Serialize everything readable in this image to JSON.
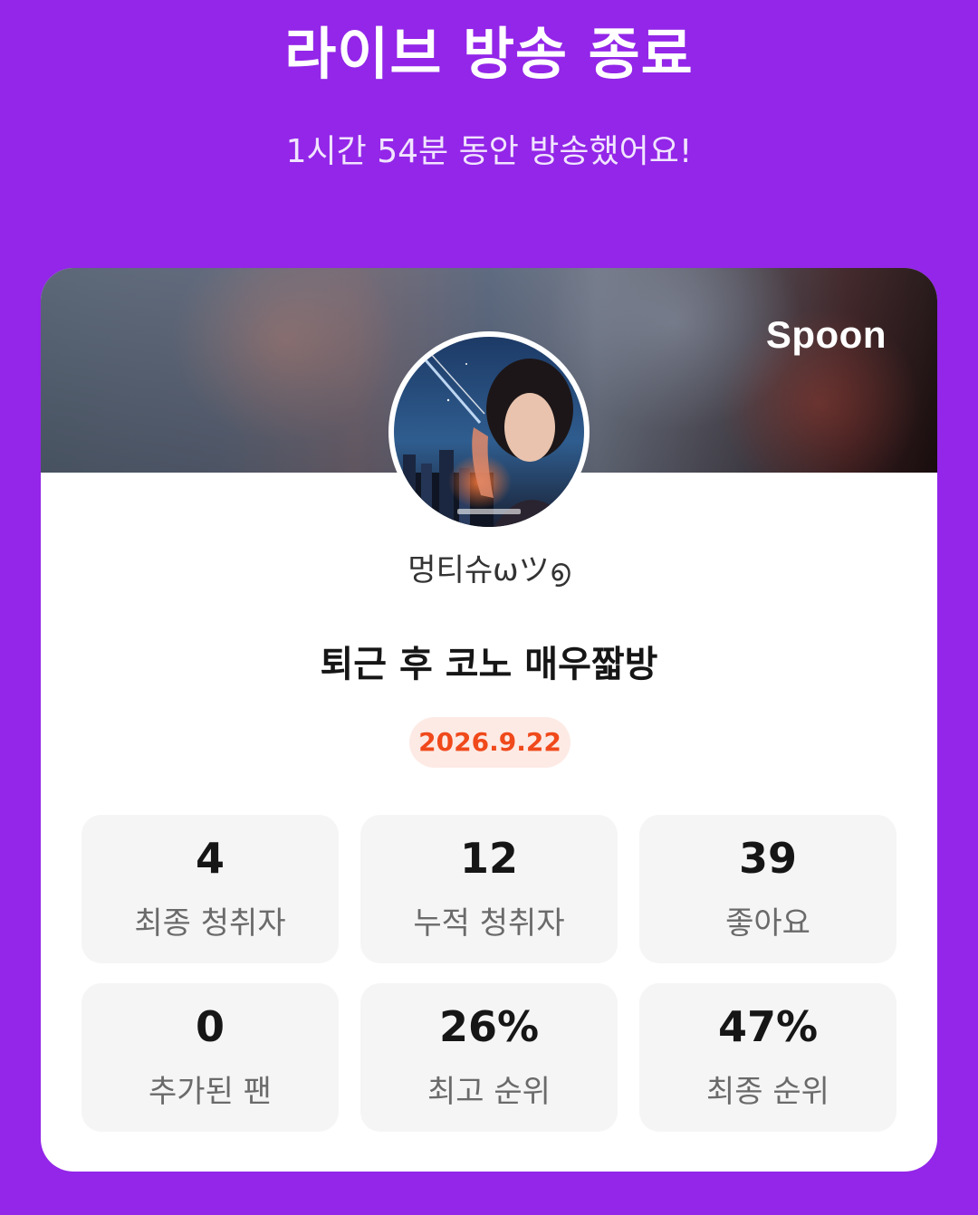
{
  "header": {
    "title": "라이브 방송 종료",
    "subtitle": "1시간 54분 동안 방송했어요!"
  },
  "card": {
    "brand": "Spoon",
    "username": "멍티슈ѡツ൭",
    "live_title": "퇴근 후 코노  매우짧방",
    "date": "2026.9.22"
  },
  "stats": [
    {
      "value": "4",
      "label": "최종 청취자"
    },
    {
      "value": "12",
      "label": "누적 청취자"
    },
    {
      "value": "39",
      "label": "좋아요"
    },
    {
      "value": "0",
      "label": "추가된 팬"
    },
    {
      "value": "26%",
      "label": "최고 순위"
    },
    {
      "value": "47%",
      "label": "최종 순위"
    }
  ],
  "colors": {
    "background": "#9326e8",
    "date_badge_bg": "#fdeae5",
    "date_badge_text": "#f0491b",
    "tile_bg": "#f5f5f5"
  }
}
